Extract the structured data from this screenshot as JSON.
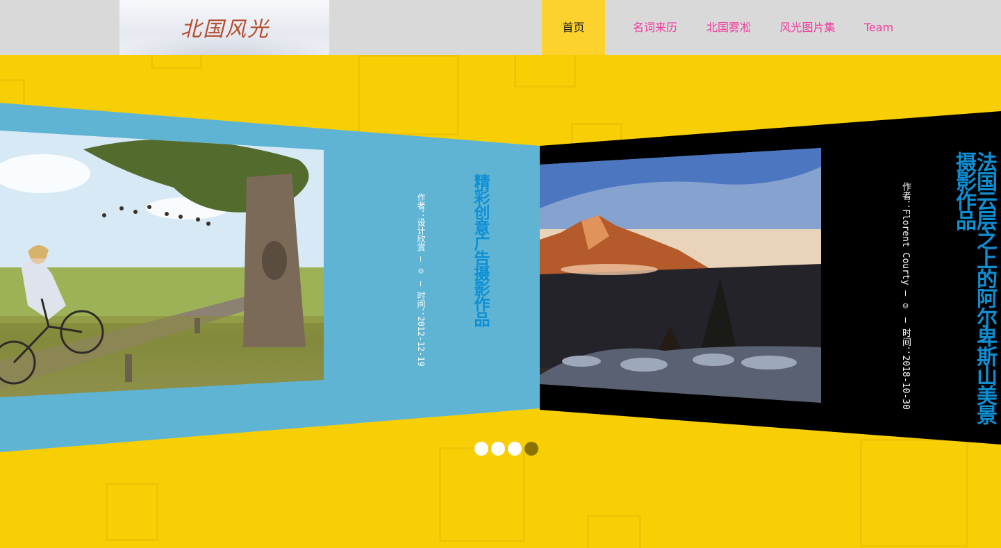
{
  "header": {
    "logo_text": "北国风光",
    "nav": [
      {
        "label": "首页",
        "active": true
      },
      {
        "label": "名词来历",
        "active": false
      },
      {
        "label": "北国雾凇",
        "active": false
      },
      {
        "label": "风光图片集",
        "active": false
      },
      {
        "label": "Team",
        "active": false
      }
    ]
  },
  "slides": [
    {
      "title": "精彩创意广告摄影作品",
      "meta": "作者：设计欣赏 — ☺ — 时间：2012-12-19",
      "panel_color": "#5fb4d3"
    },
    {
      "title": "法国云层之上的阿尔卑斯山美景摄影作品",
      "meta": "作者：Florent Courty — ☺ — 时间：2018-10-30",
      "panel_color": "#000000"
    }
  ],
  "pager": {
    "count": 4,
    "active_index": 3
  },
  "colors": {
    "background": "#f8cf05",
    "nav_active": "#fed22c",
    "nav_text": "#f0399d",
    "title_text": "#0e8fd4"
  }
}
